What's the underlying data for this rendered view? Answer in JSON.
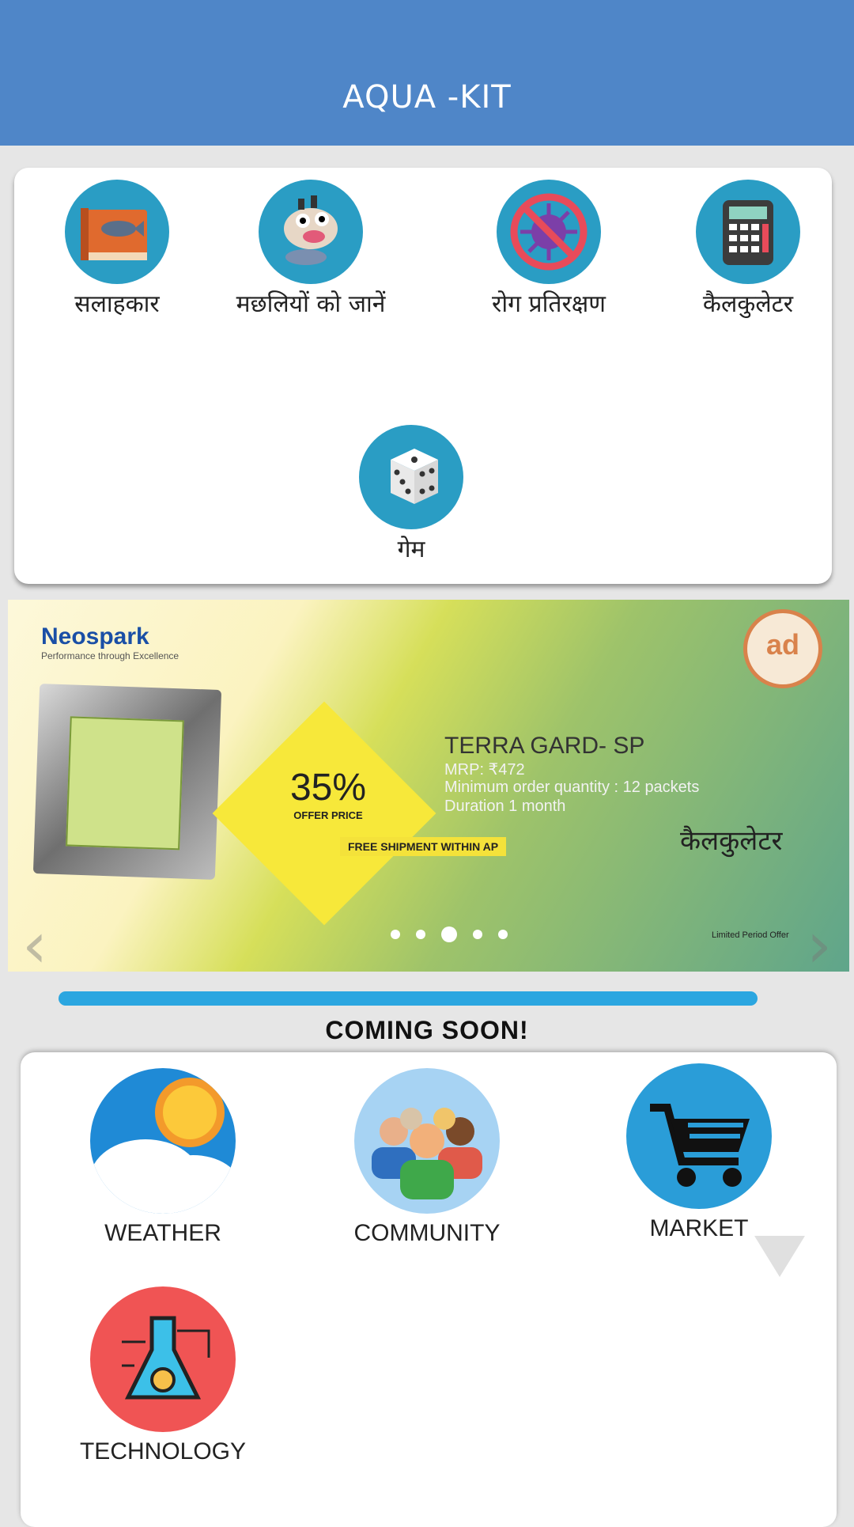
{
  "app": {
    "title": "AQUA -KIT"
  },
  "features": [
    {
      "label": "सलाहकार",
      "icon": "book-fish-icon"
    },
    {
      "label": "मछलियों को जानें",
      "icon": "fish-cartoon-icon"
    },
    {
      "label": "रोग प्रतिरक्षण",
      "icon": "no-virus-icon"
    },
    {
      "label": "कैलकुलेटर",
      "icon": "calculator-icon"
    },
    {
      "label": "गेम",
      "icon": "dice-icon"
    }
  ],
  "banner": {
    "brand": "Neospark",
    "brand_tag": "Performance through Excellence",
    "discount": "35%",
    "discount_caption": "OFFER PRICE",
    "shipping": "FREE SHIPMENT WITHIN AP",
    "product": "TERRA GARD- SP",
    "mrp": "MRP: ₹472",
    "min_order": "Minimum order quantity : 12 packets",
    "duration": "Duration 1 month",
    "overlay_label": "कैलकुलेटर",
    "ad_badge": "ad",
    "limited": "Limited Period Offer",
    "slides_total": 5,
    "slide_active": 3,
    "prev_icon": "chevron-left-icon",
    "next_icon": "chevron-right-icon"
  },
  "progress": {
    "fraction": 1.0,
    "color": "#2ba6e0"
  },
  "coming_soon": "COMING SOON!",
  "services": [
    {
      "label": "WEATHER",
      "icon": "weather-sun-cloud-icon"
    },
    {
      "label": "COMMUNITY",
      "icon": "community-people-icon"
    },
    {
      "label": "MARKET",
      "icon": "shopping-cart-icon"
    },
    {
      "label": "TECHNOLOGY",
      "icon": "flask-gear-icon"
    }
  ],
  "colors": {
    "appbar": "#4f86c8",
    "feature_circle": "#2a9dc4",
    "market": "#2a9dd8",
    "technology": "#f05454"
  }
}
